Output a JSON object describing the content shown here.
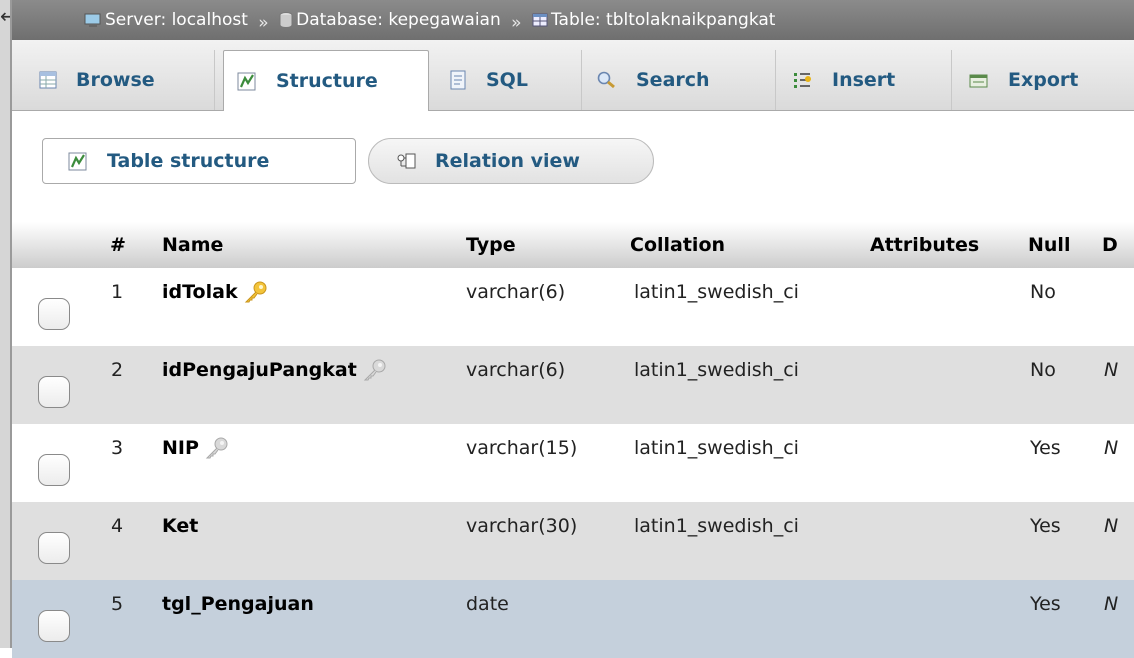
{
  "breadcrumb": {
    "server": "Server: localhost",
    "database": "Database: kepegawaian",
    "table": "Table: tbltolaknaikpangkat",
    "separator": "»"
  },
  "tabs": [
    {
      "label": "Browse",
      "icon": "browse-icon",
      "active": false
    },
    {
      "label": "Structure",
      "icon": "structure-icon",
      "active": true
    },
    {
      "label": "SQL",
      "icon": "sql-icon",
      "active": false
    },
    {
      "label": "Search",
      "icon": "search-icon",
      "active": false
    },
    {
      "label": "Insert",
      "icon": "insert-icon",
      "active": false
    },
    {
      "label": "Export",
      "icon": "export-icon",
      "active": false
    }
  ],
  "subtabs": [
    {
      "label": "Table structure",
      "icon": "structure-icon",
      "active": true
    },
    {
      "label": "Relation view",
      "icon": "relation-icon",
      "active": false
    }
  ],
  "table": {
    "headers": {
      "num": "#",
      "name": "Name",
      "type": "Type",
      "collation": "Collation",
      "attributes": "Attributes",
      "null": "Null",
      "default": "D"
    },
    "rows": [
      {
        "num": "1",
        "name": "idTolak",
        "key": "primary",
        "type": "varchar(6)",
        "collation": "latin1_swedish_ci",
        "attributes": "",
        "null": "No",
        "default": ""
      },
      {
        "num": "2",
        "name": "idPengajuPangkat",
        "key": "index",
        "type": "varchar(6)",
        "collation": "latin1_swedish_ci",
        "attributes": "",
        "null": "No",
        "default": "N"
      },
      {
        "num": "3",
        "name": "NIP",
        "key": "index",
        "type": "varchar(15)",
        "collation": "latin1_swedish_ci",
        "attributes": "",
        "null": "Yes",
        "default": "N"
      },
      {
        "num": "4",
        "name": "Ket",
        "key": "",
        "type": "varchar(30)",
        "collation": "latin1_swedish_ci",
        "attributes": "",
        "null": "Yes",
        "default": "N"
      },
      {
        "num": "5",
        "name": "tgl_Pengajuan",
        "key": "",
        "type": "date",
        "collation": "",
        "attributes": "",
        "null": "Yes",
        "default": "N"
      }
    ]
  },
  "colors": {
    "link": "#235a81",
    "breadcrumb_bg": "#7d7d7d",
    "row_even": "#dfdfdf",
    "row_hover": "#c5d0dc",
    "primary_key": "#e8b417",
    "index_key": "#b5b5b5"
  }
}
